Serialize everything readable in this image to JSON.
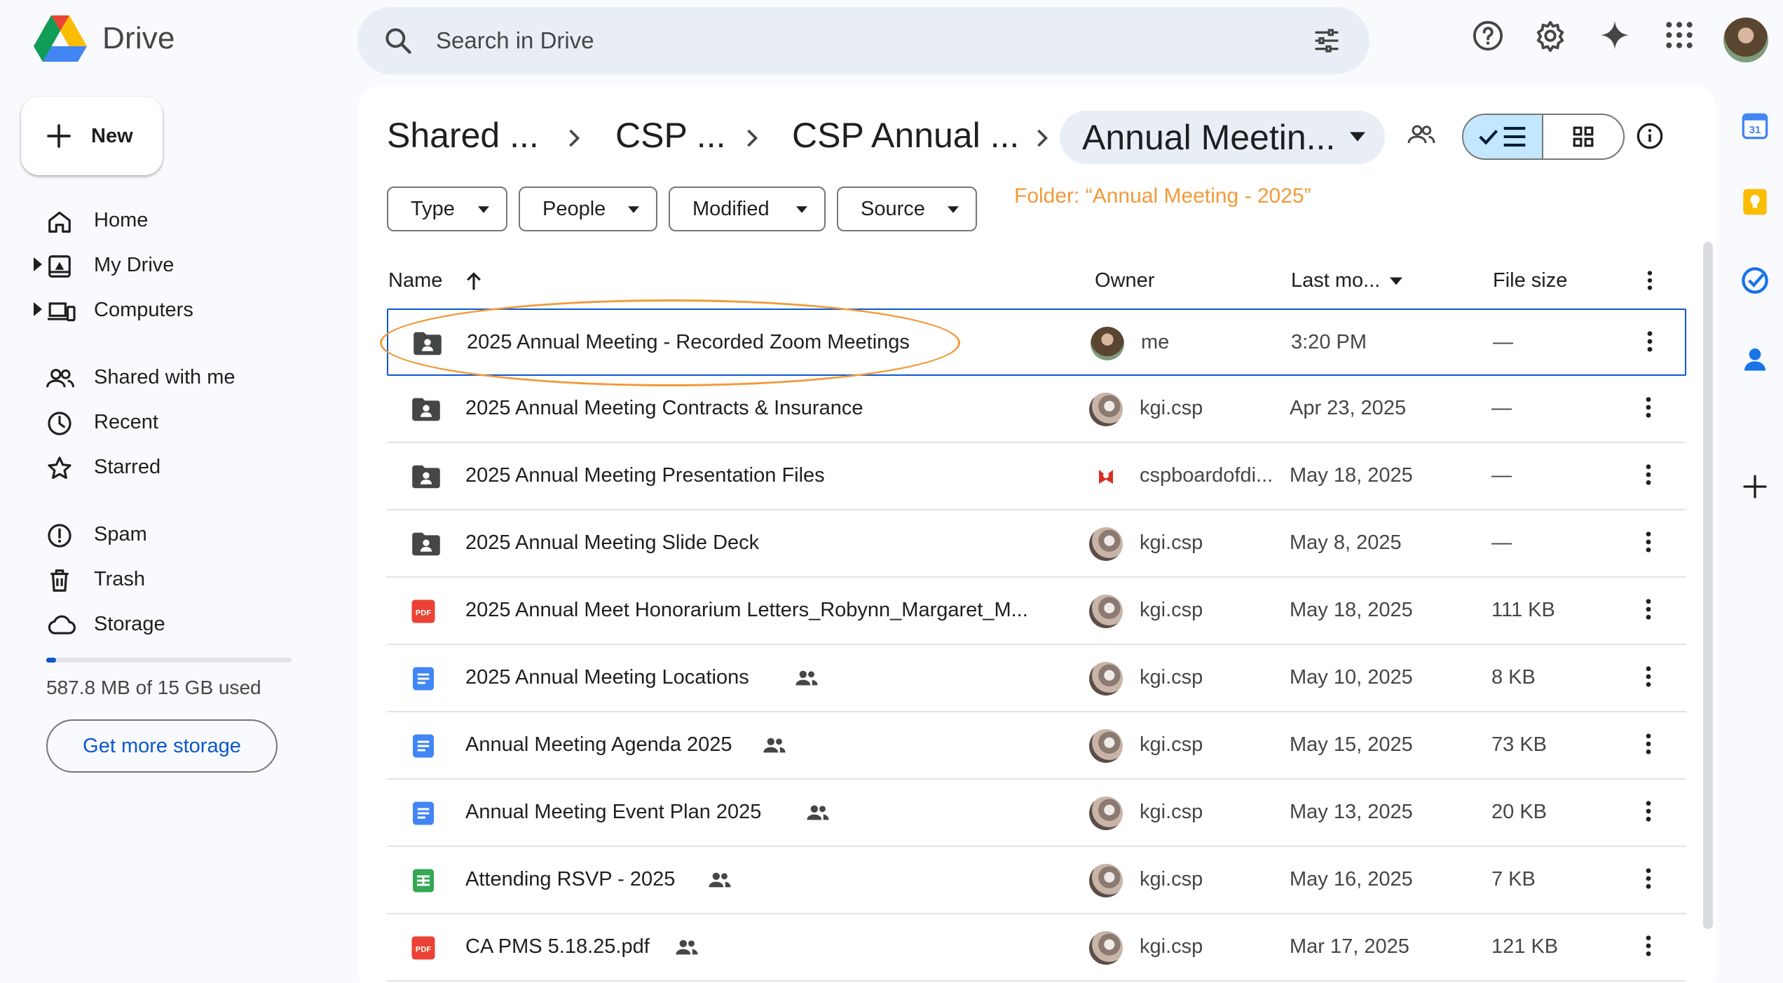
{
  "app": {
    "name": "Drive"
  },
  "search": {
    "placeholder": "Search in Drive"
  },
  "sidebar": {
    "new_label": "New",
    "items": [
      {
        "label": "Home",
        "icon": "home-icon"
      },
      {
        "label": "My Drive",
        "icon": "my-drive-icon"
      },
      {
        "label": "Computers",
        "icon": "computers-icon"
      },
      {
        "label": "Shared with me",
        "icon": "people-icon"
      },
      {
        "label": "Recent",
        "icon": "clock-icon"
      },
      {
        "label": "Starred",
        "icon": "star-icon"
      },
      {
        "label": "Spam",
        "icon": "spam-icon"
      },
      {
        "label": "Trash",
        "icon": "trash-icon"
      },
      {
        "label": "Storage",
        "icon": "cloud-icon"
      }
    ],
    "storage": {
      "used_text": "587.8 MB of 15 GB used",
      "used_fraction": 0.04,
      "button_label": "Get more storage"
    }
  },
  "breadcrumb": [
    "Shared ...",
    "CSP ...",
    "CSP Annual ...",
    "Annual Meetin..."
  ],
  "filters": [
    "Type",
    "People",
    "Modified",
    "Source"
  ],
  "annotation": "Folder: “Annual Meeting - 2025”",
  "table": {
    "headers": {
      "name": "Name",
      "owner": "Owner",
      "modified": "Last mo...",
      "size": "File size"
    },
    "rows": [
      {
        "type": "shared-folder",
        "name": "2025 Annual Meeting - Recorded Zoom Meetings",
        "owner": "me",
        "date": "3:20 PM",
        "size": "—",
        "shared": false
      },
      {
        "type": "shared-folder",
        "name": "2025 Annual Meeting Contracts & Insurance",
        "owner": "kgi.csp",
        "date": "Apr 23, 2025",
        "size": "—",
        "shared": false
      },
      {
        "type": "shared-folder",
        "name": "2025 Annual Meeting Presentation Files",
        "owner": "cspboardofdi...",
        "date": "May 18, 2025",
        "size": "—",
        "shared": false
      },
      {
        "type": "shared-folder",
        "name": "2025 Annual Meeting Slide Deck",
        "owner": "kgi.csp",
        "date": "May 8, 2025",
        "size": "—",
        "shared": false
      },
      {
        "type": "pdf",
        "name": "2025 Annual Meet Honorarium Letters_Robynn_Margaret_M...",
        "owner": "kgi.csp",
        "date": "May 18, 2025",
        "size": "111 KB",
        "shared": true
      },
      {
        "type": "doc",
        "name": "2025 Annual Meeting Locations",
        "owner": "kgi.csp",
        "date": "May 10, 2025",
        "size": "8 KB",
        "shared": true
      },
      {
        "type": "doc",
        "name": "Annual Meeting Agenda 2025",
        "owner": "kgi.csp",
        "date": "May 15, 2025",
        "size": "73 KB",
        "shared": true
      },
      {
        "type": "doc",
        "name": "Annual Meeting Event Plan 2025",
        "owner": "kgi.csp",
        "date": "May 13, 2025",
        "size": "20 KB",
        "shared": true
      },
      {
        "type": "sheet",
        "name": "Attending RSVP - 2025",
        "owner": "kgi.csp",
        "date": "May 16, 2025",
        "size": "7 KB",
        "shared": true
      },
      {
        "type": "pdf",
        "name": "CA PMS 5.18.25.pdf",
        "owner": "kgi.csp",
        "date": "Mar 17, 2025",
        "size": "121 KB",
        "shared": true
      }
    ]
  },
  "icon_labels": {
    "pdf": "PDF",
    "calendar": "31"
  },
  "colors": {
    "accent": "#0b57d0",
    "annotation": "#f29a3a",
    "pdf": "#ea4335",
    "doc": "#4285f4",
    "sheet": "#34a853"
  }
}
